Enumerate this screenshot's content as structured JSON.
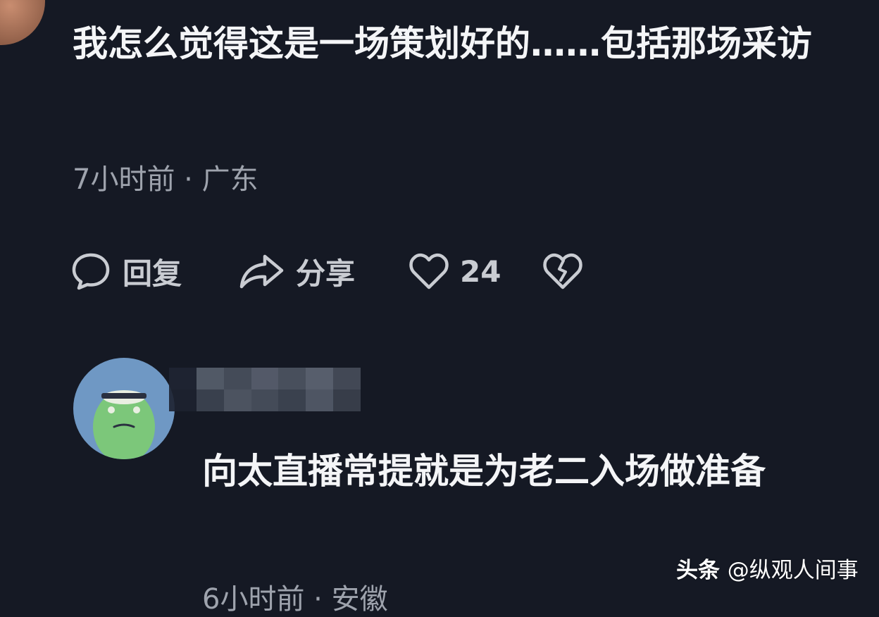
{
  "comments": [
    {
      "text": "我怎么觉得这是一场策划好的……包括那场采访",
      "meta": "7小时前 · 广东",
      "actions": {
        "reply_label": "回复",
        "share_label": "分享",
        "like_count": "24"
      }
    },
    {
      "text": "向太直播常提就是为老二入场做准备",
      "meta": "6小时前 · 安徽"
    }
  ],
  "watermark": {
    "brand": "头条",
    "handle": "@纵观人间事"
  },
  "icons": {
    "reply": "speech-bubble-icon",
    "share": "share-arrow-icon",
    "like": "heart-icon",
    "dislike": "broken-heart-icon"
  },
  "colors": {
    "background": "#151924",
    "text": "#f4f5f7",
    "meta": "#9ea3ad",
    "avatar_bg": "#6f98c4",
    "avatar_face": "#7cc77a"
  }
}
